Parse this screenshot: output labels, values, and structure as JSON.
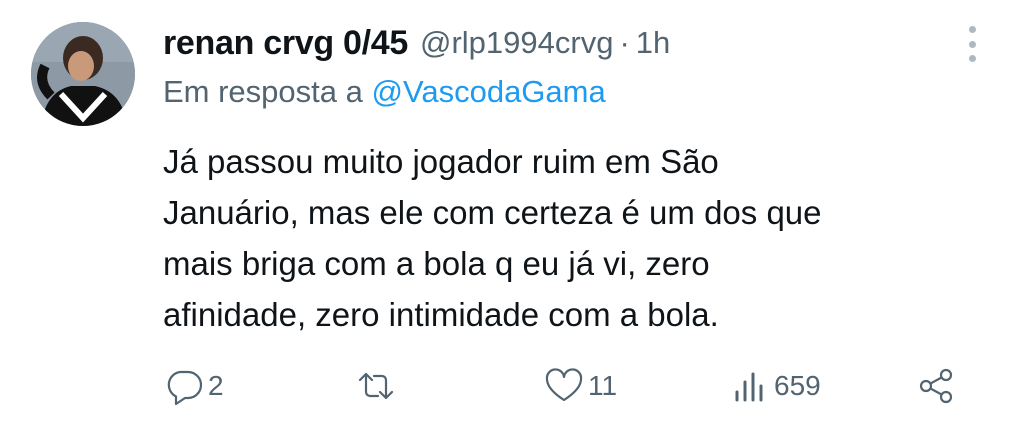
{
  "author": {
    "display_name": "renan crvg 0/45",
    "handle": "@rlp1994crvg",
    "separator": "·",
    "time": "1h"
  },
  "reply_context": {
    "prefix": "Em resposta a",
    "mention": "@VascodaGama"
  },
  "tweet": {
    "lines": [
      "Já passou muito jogador ruim em São",
      "Januário, mas ele com certeza é um dos que",
      "mais briga com a bola q eu já vi, zero",
      "afinidade, zero intimidade com a bola."
    ]
  },
  "actions": {
    "replies": "2",
    "retweets": "",
    "likes": "11",
    "views": "659"
  },
  "icons": {
    "reply": "reply-icon",
    "retweet": "retweet-icon",
    "like": "heart-icon",
    "views": "views-icon",
    "share": "share-icon",
    "more": "more-icon"
  },
  "colors": {
    "text": "#0f1419",
    "secondary": "#536471",
    "link": "#1d9bf0"
  }
}
